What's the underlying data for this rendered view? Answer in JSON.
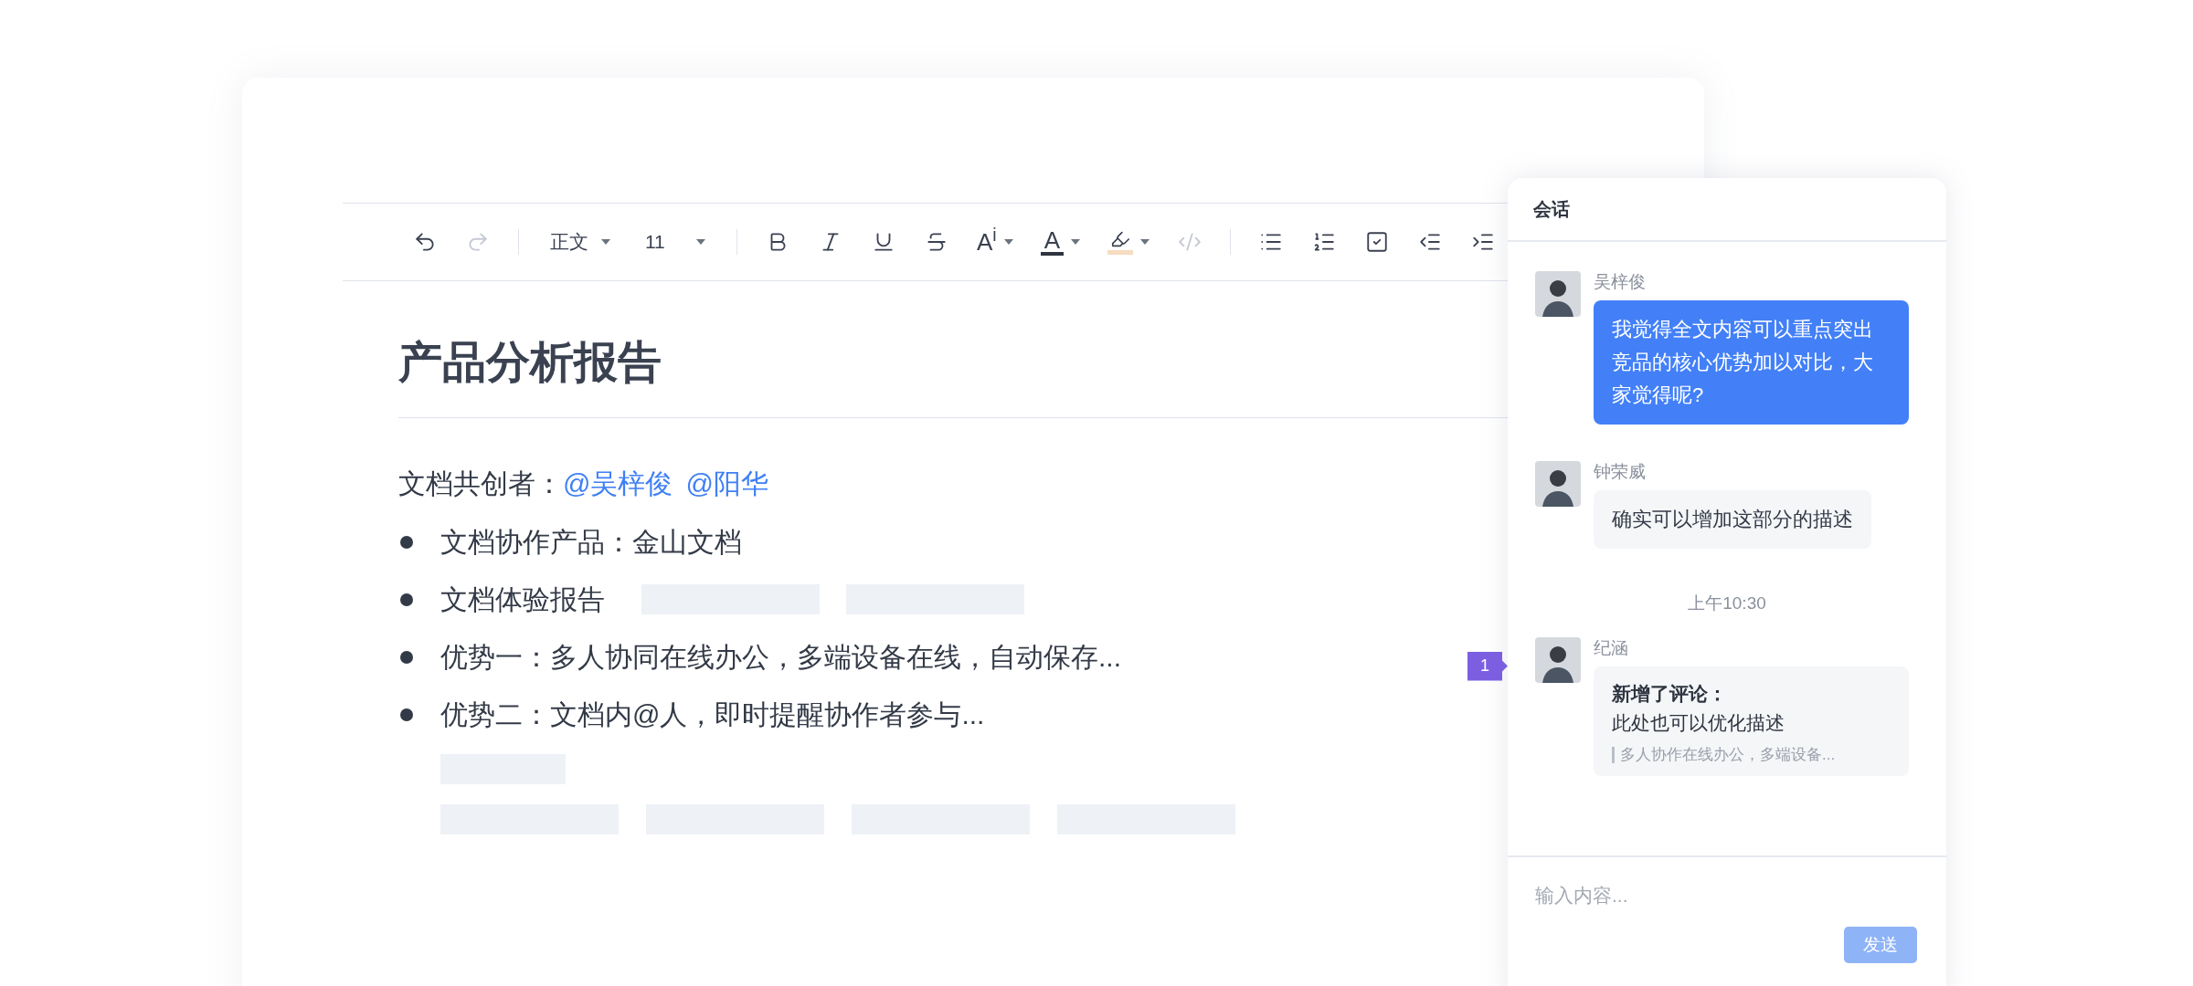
{
  "toolbar": {
    "groups": [
      [
        {
          "kind": "undo",
          "disabled": false
        },
        {
          "kind": "redo",
          "disabled": true
        }
      ],
      [
        {
          "kind": "select",
          "value": "正文",
          "disabled": false
        },
        {
          "kind": "select",
          "value": "11",
          "disabled": false
        }
      ],
      [
        {
          "kind": "bold",
          "disabled": false
        },
        {
          "kind": "italic",
          "disabled": false
        },
        {
          "kind": "underline",
          "disabled": false
        },
        {
          "kind": "strike",
          "disabled": false
        },
        {
          "kind": "text_effect",
          "label": "A$^{i}$",
          "disabled": false
        },
        {
          "kind": "font_color",
          "label": "A",
          "disabled": false
        },
        {
          "kind": "highlight",
          "disabled": false
        },
        {
          "kind": "code",
          "disabled": true
        }
      ],
      [
        {
          "kind": "bullet_list",
          "disabled": false
        },
        {
          "kind": "numbered_list",
          "disabled": false
        },
        {
          "kind": "task",
          "disabled": false
        },
        {
          "kind": "outdent",
          "disabled": false
        },
        {
          "kind": "indent",
          "disabled": false
        }
      ]
    ]
  },
  "document": {
    "title": "产品分析报告",
    "coauthors_label": "文档共创者：",
    "mentions": [
      "@吴梓俊",
      "@阳华"
    ],
    "bullets": [
      {
        "text": "文档协作产品：金山文档"
      },
      {
        "text": "文档体验报告"
      },
      {
        "text": "优势一：多人协同在线办公，多端设备在线，自动保存..."
      },
      {
        "text": "优势二：文档内@人，即时提醒协作者参与..."
      }
    ]
  },
  "chat": {
    "title": "会话",
    "messages": [
      {
        "kind": "message",
        "sender": "吴梓俊",
        "text": "我觉得全文内容可以重点突出竞品的核心优势加以对比，大家觉得呢?",
        "highlighted": true
      },
      {
        "kind": "message",
        "sender": "钟荣威",
        "text": "确实可以增加这部分的描述",
        "highlighted": false
      },
      {
        "kind": "time",
        "text": "上午10:30"
      },
      {
        "kind": "comment",
        "sender": "纪涵",
        "badge": "1",
        "heading": "新增了评论：",
        "text": "此处也可以优化描述",
        "quote": "多人协作在线办公，多端设备..."
      }
    ],
    "input": {
      "placeholder": "输入内容..."
    },
    "send_button": {
      "label": "发送",
      "disabled": true
    }
  }
}
